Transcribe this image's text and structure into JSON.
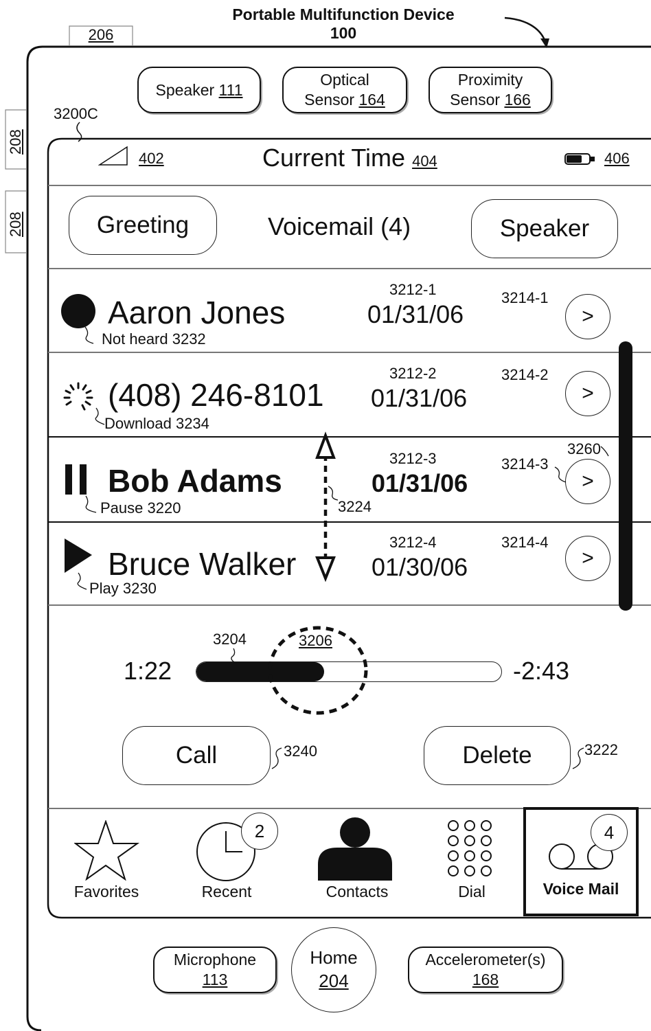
{
  "header": {
    "title_line1": "Portable Multifunction Device",
    "title_line2": "100",
    "ref_206": "206",
    "ref_208a": "208",
    "ref_208b": "208",
    "ref_3200c": "3200C"
  },
  "top_hardware": {
    "speaker": {
      "label": "Speaker",
      "ref": "111"
    },
    "optical": {
      "label1": "Optical",
      "label2": "Sensor",
      "ref": "164"
    },
    "proximity": {
      "label1": "Proximity",
      "label2": "Sensor",
      "ref": "166"
    }
  },
  "status_bar": {
    "signal_ref": "402",
    "title": "Current Time",
    "time_ref": "404",
    "battery_ref": "406"
  },
  "toolbar": {
    "greeting": "Greeting",
    "title": "Voicemail (4)",
    "speaker": "Speaker"
  },
  "voicemails": [
    {
      "name": "Aaron Jones",
      "date": "01/31/06",
      "date_ref": "3212-1",
      "detail_ref": "3214-1",
      "status": "Not heard 3232",
      "status_icon": "unheard-dot-icon"
    },
    {
      "name": "(408) 246-8101",
      "date": "01/31/06",
      "date_ref": "3212-2",
      "detail_ref": "3214-2",
      "status": "Download 3234",
      "status_icon": "download-spinner-icon"
    },
    {
      "name": "Bob Adams",
      "date": "01/31/06",
      "date_ref": "3212-3",
      "detail_ref": "3214-3",
      "status": "Pause 3220",
      "status_icon": "pause-icon"
    },
    {
      "name": "Bruce Walker",
      "date": "01/30/06",
      "date_ref": "3212-4",
      "detail_ref": "3214-4",
      "status": "Play 3230",
      "status_icon": "play-icon"
    }
  ],
  "chevron": ">",
  "refs": {
    "scroll": "3260",
    "drag": "3224",
    "progress": "3204",
    "scrubber": "3206",
    "call_ref": "3240",
    "delete_ref": "3222"
  },
  "player": {
    "elapsed": "1:22",
    "remaining": "-2:43",
    "progress_fraction": 0.42
  },
  "actions": {
    "call": "Call",
    "delete": "Delete"
  },
  "tabs": [
    {
      "label": "Favorites",
      "icon": "star-icon"
    },
    {
      "label": "Recent",
      "icon": "clock-icon",
      "badge": "2"
    },
    {
      "label": "Contacts",
      "icon": "person-icon"
    },
    {
      "label": "Dial",
      "icon": "keypad-icon"
    },
    {
      "label": "Voice Mail",
      "icon": "voicemail-icon",
      "badge": "4",
      "selected": true
    }
  ],
  "bottom_hardware": {
    "microphone": {
      "label": "Microphone",
      "ref": "113"
    },
    "home": {
      "label": "Home",
      "ref": "204"
    },
    "accelerometer": {
      "label": "Accelerometer(s)",
      "ref": "168"
    }
  }
}
